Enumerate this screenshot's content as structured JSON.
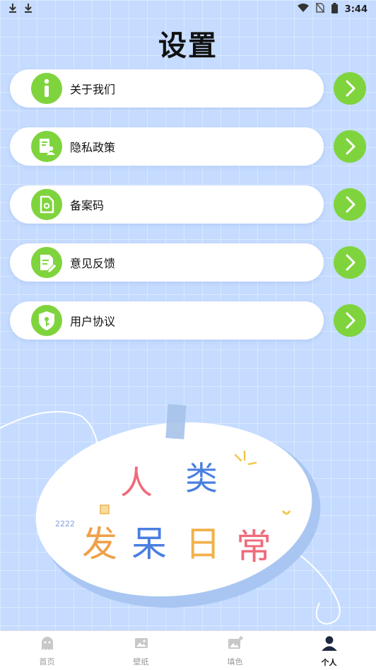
{
  "status_bar": {
    "time": "3:44"
  },
  "header": {
    "title": "设置"
  },
  "menu": [
    {
      "id": "about",
      "label": "关于我们",
      "icon": "info-icon"
    },
    {
      "id": "privacy",
      "label": "隐私政策",
      "icon": "document-person-icon"
    },
    {
      "id": "icp",
      "label": "备案码",
      "icon": "file-icon"
    },
    {
      "id": "feedback",
      "label": "意见反馈",
      "icon": "edit-note-icon"
    },
    {
      "id": "agreement",
      "label": "用户协议",
      "icon": "shield-key-icon"
    }
  ],
  "illustration": {
    "line1": [
      "人",
      "类"
    ],
    "line2": [
      "发",
      "呆",
      "日",
      "常"
    ],
    "doodle": "2222"
  },
  "tabs": [
    {
      "label": "首页",
      "icon": "ghost-icon",
      "active": false
    },
    {
      "label": "壁纸",
      "icon": "image-icon",
      "active": false
    },
    {
      "label": "填色",
      "icon": "image-plus-icon",
      "active": false
    },
    {
      "label": "个人",
      "icon": "person-icon",
      "active": true
    }
  ],
  "colors": {
    "accent": "#7fd43d",
    "background": "#c5dbff"
  }
}
